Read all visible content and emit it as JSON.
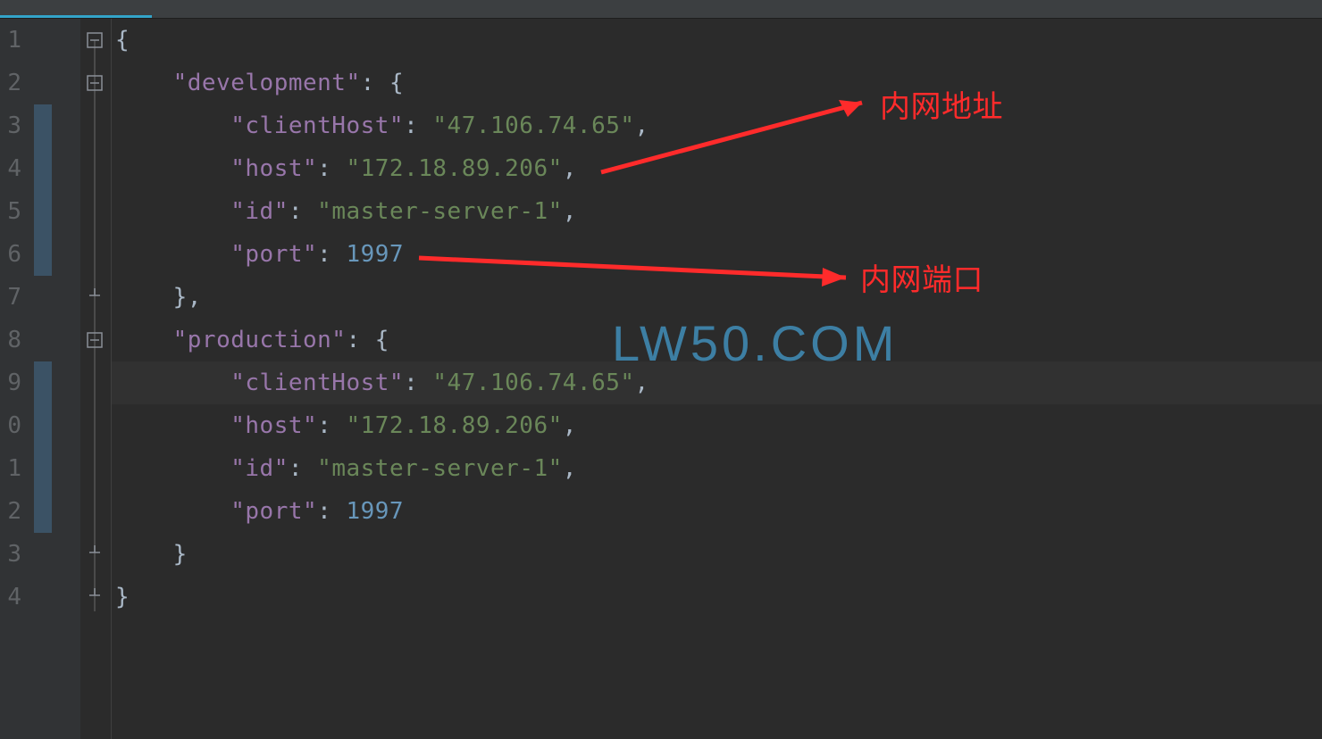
{
  "lineNumbers": [
    "1",
    "2",
    "3",
    "4",
    "5",
    "6",
    "7",
    "8",
    "9",
    "0",
    "1",
    "2",
    "3",
    "4"
  ],
  "highlightedLineIndex": 8,
  "markedLineIndices": [
    2,
    3,
    4,
    5,
    8,
    9,
    10,
    11
  ],
  "foldIcons": [
    {
      "lineIndex": 0,
      "shape": "minus-top"
    },
    {
      "lineIndex": 1,
      "shape": "minus"
    },
    {
      "lineIndex": 6,
      "shape": "close"
    },
    {
      "lineIndex": 7,
      "shape": "minus"
    },
    {
      "lineIndex": 12,
      "shape": "close"
    },
    {
      "lineIndex": 13,
      "shape": "close-bottom"
    }
  ],
  "code": [
    [
      {
        "t": "brc",
        "v": "{"
      }
    ],
    [
      {
        "t": "pun",
        "v": "    "
      },
      {
        "t": "key",
        "v": "\"development\""
      },
      {
        "t": "pun",
        "v": ": "
      },
      {
        "t": "brc",
        "v": "{"
      }
    ],
    [
      {
        "t": "pun",
        "v": "        "
      },
      {
        "t": "key",
        "v": "\"clientHost\""
      },
      {
        "t": "pun",
        "v": ": "
      },
      {
        "t": "str",
        "v": "\"47.106.74.65\""
      },
      {
        "t": "pun",
        "v": ","
      }
    ],
    [
      {
        "t": "pun",
        "v": "        "
      },
      {
        "t": "key",
        "v": "\"host\""
      },
      {
        "t": "pun",
        "v": ": "
      },
      {
        "t": "str",
        "v": "\"172.18.89.206\""
      },
      {
        "t": "pun",
        "v": ","
      }
    ],
    [
      {
        "t": "pun",
        "v": "        "
      },
      {
        "t": "key",
        "v": "\"id\""
      },
      {
        "t": "pun",
        "v": ": "
      },
      {
        "t": "str",
        "v": "\"master-server-1\""
      },
      {
        "t": "pun",
        "v": ","
      }
    ],
    [
      {
        "t": "pun",
        "v": "        "
      },
      {
        "t": "key",
        "v": "\"port\""
      },
      {
        "t": "pun",
        "v": ": "
      },
      {
        "t": "num",
        "v": "1997"
      }
    ],
    [
      {
        "t": "pun",
        "v": "    "
      },
      {
        "t": "brc",
        "v": "}"
      },
      {
        "t": "pun",
        "v": ","
      }
    ],
    [
      {
        "t": "pun",
        "v": "    "
      },
      {
        "t": "key",
        "v": "\"production\""
      },
      {
        "t": "pun",
        "v": ": "
      },
      {
        "t": "brc",
        "v": "{"
      }
    ],
    [
      {
        "t": "pun",
        "v": "        "
      },
      {
        "t": "key",
        "v": "\"clientHost\""
      },
      {
        "t": "pun",
        "v": ": "
      },
      {
        "t": "str",
        "v": "\"47.106.74.65\""
      },
      {
        "t": "pun",
        "v": ","
      }
    ],
    [
      {
        "t": "pun",
        "v": "        "
      },
      {
        "t": "key",
        "v": "\"host\""
      },
      {
        "t": "pun",
        "v": ": "
      },
      {
        "t": "str",
        "v": "\"172.18.89.206\""
      },
      {
        "t": "pun",
        "v": ","
      }
    ],
    [
      {
        "t": "pun",
        "v": "        "
      },
      {
        "t": "key",
        "v": "\"id\""
      },
      {
        "t": "pun",
        "v": ": "
      },
      {
        "t": "str",
        "v": "\"master-server-1\""
      },
      {
        "t": "pun",
        "v": ","
      }
    ],
    [
      {
        "t": "pun",
        "v": "        "
      },
      {
        "t": "key",
        "v": "\"port\""
      },
      {
        "t": "pun",
        "v": ": "
      },
      {
        "t": "num",
        "v": "1997"
      }
    ],
    [
      {
        "t": "pun",
        "v": "    "
      },
      {
        "t": "brc",
        "v": "}"
      }
    ],
    [
      {
        "t": "brc",
        "v": "}"
      }
    ]
  ],
  "annotations": {
    "host_label": "内网地址",
    "port_label": "内网端口"
  },
  "watermark": "LW50.COM"
}
